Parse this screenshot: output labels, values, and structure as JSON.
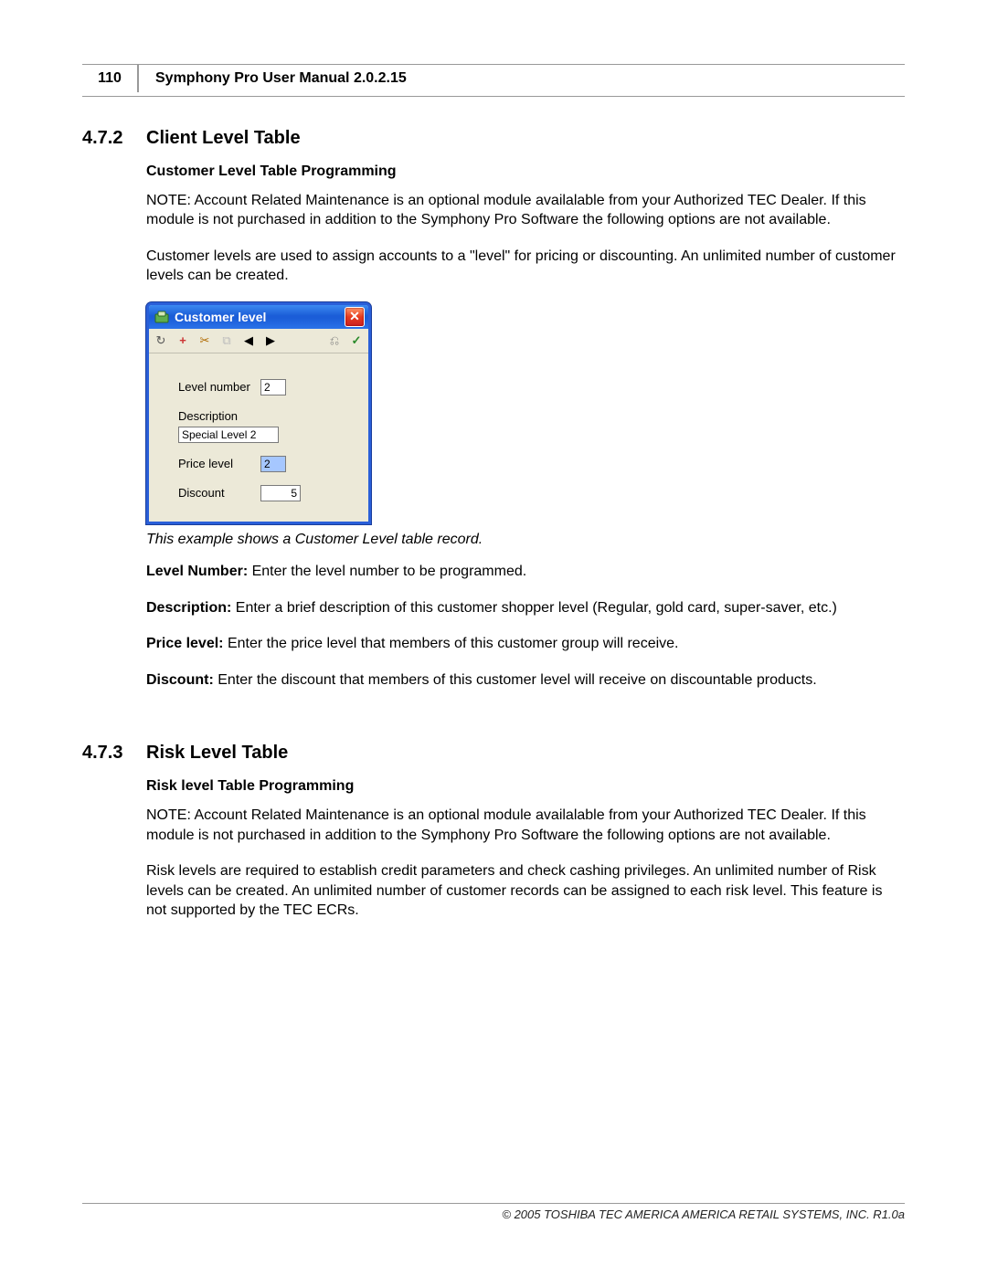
{
  "header": {
    "page_number": "110",
    "doc_title": "Symphony Pro User Manual  2.0.2.15"
  },
  "section1": {
    "number": "4.7.2",
    "title": "Client Level Table",
    "subheading": "Customer Level Table Programming",
    "note": "NOTE: Account Related Maintenance is an optional module availalable from your Authorized TEC Dealer. If this module is not purchased in addition to the Symphony Pro Software the following options are not available.",
    "para1": " Customer levels are used to assign accounts to a \"level\" for pricing or discounting. An unlimited number of customer levels can be created.",
    "caption": "This example shows a Customer Level table record.",
    "defs": {
      "level_number_label": "Level Number:",
      "level_number_text": "   Enter the level number to be programmed.",
      "description_label": "Description:",
      "description_text": "   Enter a brief description of this customer shopper level (Regular, gold card, super-saver, etc.)",
      "price_level_label": "Price level:",
      "price_level_text": "   Enter the price level that members of this customer group will receive.",
      "discount_label": "Discount:",
      "discount_text": "   Enter the discount that members of this customer level will receive on discountable products."
    }
  },
  "dialog": {
    "title": "Customer level",
    "close": "✕",
    "fields": {
      "level_number_label": "Level number",
      "level_number_value": "2",
      "description_label": "Description",
      "description_value": "Special Level 2",
      "price_level_label": "Price level",
      "price_level_value": "2",
      "discount_label": "Discount",
      "discount_value": "5"
    }
  },
  "section2": {
    "number": "4.7.3",
    "title": "Risk Level Table",
    "subheading": "Risk level Table Programming",
    "note": "NOTE: Account Related Maintenance is an optional module availalable from your Authorized TEC Dealer. If this module is not purchased in addition to the Symphony Pro Software the following options are not available.",
    "para1": " Risk levels are required to establish credit parameters and check cashing privileges. An unlimited number of Risk levels can be created. An unlimited number of customer records can be assigned to each risk level. This feature is not supported by the TEC ECRs."
  },
  "footer": "© 2005 TOSHIBA TEC AMERICA AMERICA RETAIL SYSTEMS, INC.   R1.0a"
}
